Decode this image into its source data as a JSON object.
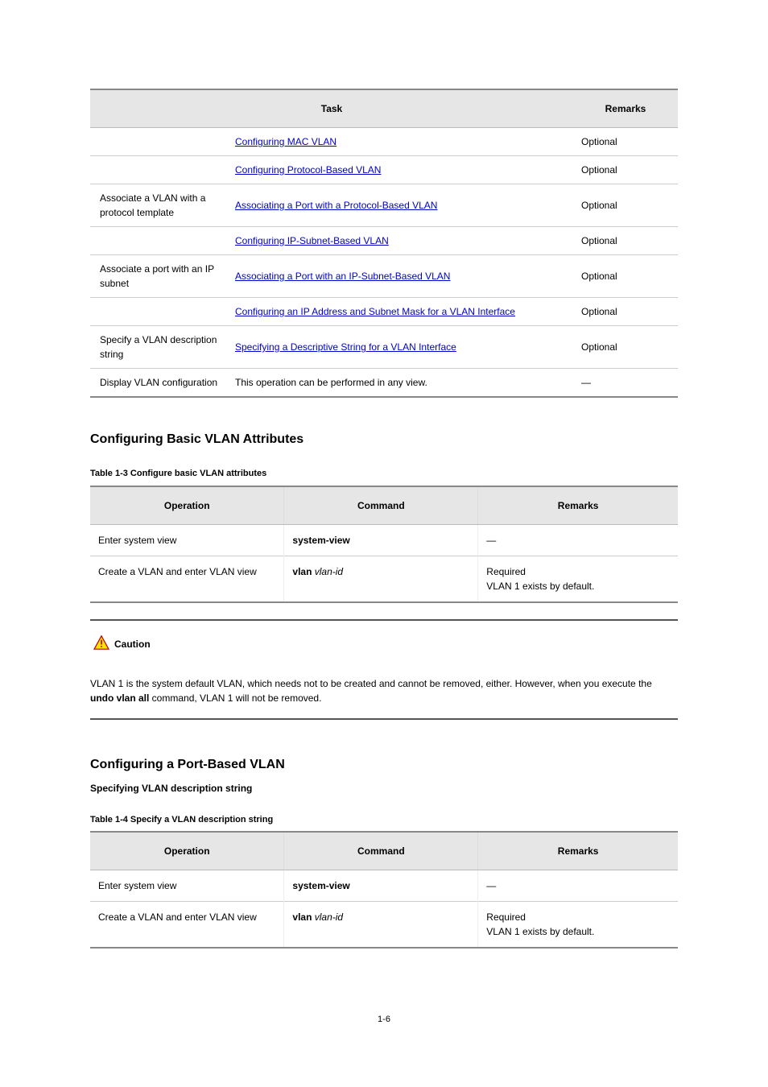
{
  "table1": {
    "headers": [
      "Task",
      "Remarks"
    ],
    "rows": [
      {
        "c1": "Optional",
        "link1": "Configuring MAC VLAN",
        "link2": "Configuring Protocol-Based VLAN",
        "link2_tail": "",
        "c3": "Optional"
      },
      {
        "c1": "Associate a VLAN with a protocol template",
        "link": "Associating a Port with a Protocol-Based VLAN",
        "c3": "Optional"
      },
      {
        "c1": "",
        "link": "Configuring IP-Subnet-Based VLAN",
        "c3": "Optional"
      },
      {
        "c1": "Associate a port with an IP subnet",
        "link": "Associating a Port with an IP-Subnet-Based VLAN",
        "c3": "Optional"
      },
      {
        "c1": "",
        "link_pre": "",
        "link": "Configuring an IP Address and Subnet Mask for a VLAN Interface",
        "c3": "Optional"
      },
      {
        "c1": "Specify a VLAN description string",
        "link": "Specifying a Descriptive String for a VLAN Interface",
        "c3": "Optional"
      },
      {
        "c1": "Display VLAN configuration",
        "c2": "This operation can be performed in any view.",
        "c3": "—"
      }
    ]
  },
  "section1_title": "Configuring Basic VLAN Attributes",
  "section1_caption": "Table 1-3 Configure basic VLAN attributes",
  "table2": {
    "headers": [
      "Operation",
      "Command",
      "Remarks"
    ],
    "rows": [
      {
        "c1": "Enter system view",
        "c2": "system-view",
        "c3": "—",
        "c3_extra": ""
      },
      {
        "c1": "Create a VLAN and enter VLAN view",
        "c2": "vlan vlan-id",
        "c2_b": "vlan",
        "c2_i": " vlan-id",
        "c3_l1": "Required",
        "c3_l2": "VLAN 1 exists by default."
      }
    ]
  },
  "caution": {
    "label": "Caution",
    "body_pre": "VLAN 1 is the system default VLAN, which needs not to be created and cannot be removed, either. However, when you execute the ",
    "body_cmd": "undo vlan all",
    "body_post": " command, VLAN 1 will not be removed."
  },
  "section2_title": "Configuring a Port-Based VLAN",
  "section2_sub": "Specifying VLAN description string",
  "section2_caption": "Table 1-4 Specify a VLAN description string",
  "table3": {
    "headers": [
      "Operation",
      "Command",
      "Remarks"
    ],
    "rows": [
      {
        "c1": "Enter system view",
        "c2": "system-view",
        "c3": "—",
        "c3_extra": ""
      },
      {
        "c1": "Create a VLAN and enter VLAN view",
        "c2_b": "vlan",
        "c2_i": " vlan-id",
        "c3_l1": "Required",
        "c3_l2": "VLAN 1 exists by default."
      }
    ]
  },
  "page_number": "1-6"
}
